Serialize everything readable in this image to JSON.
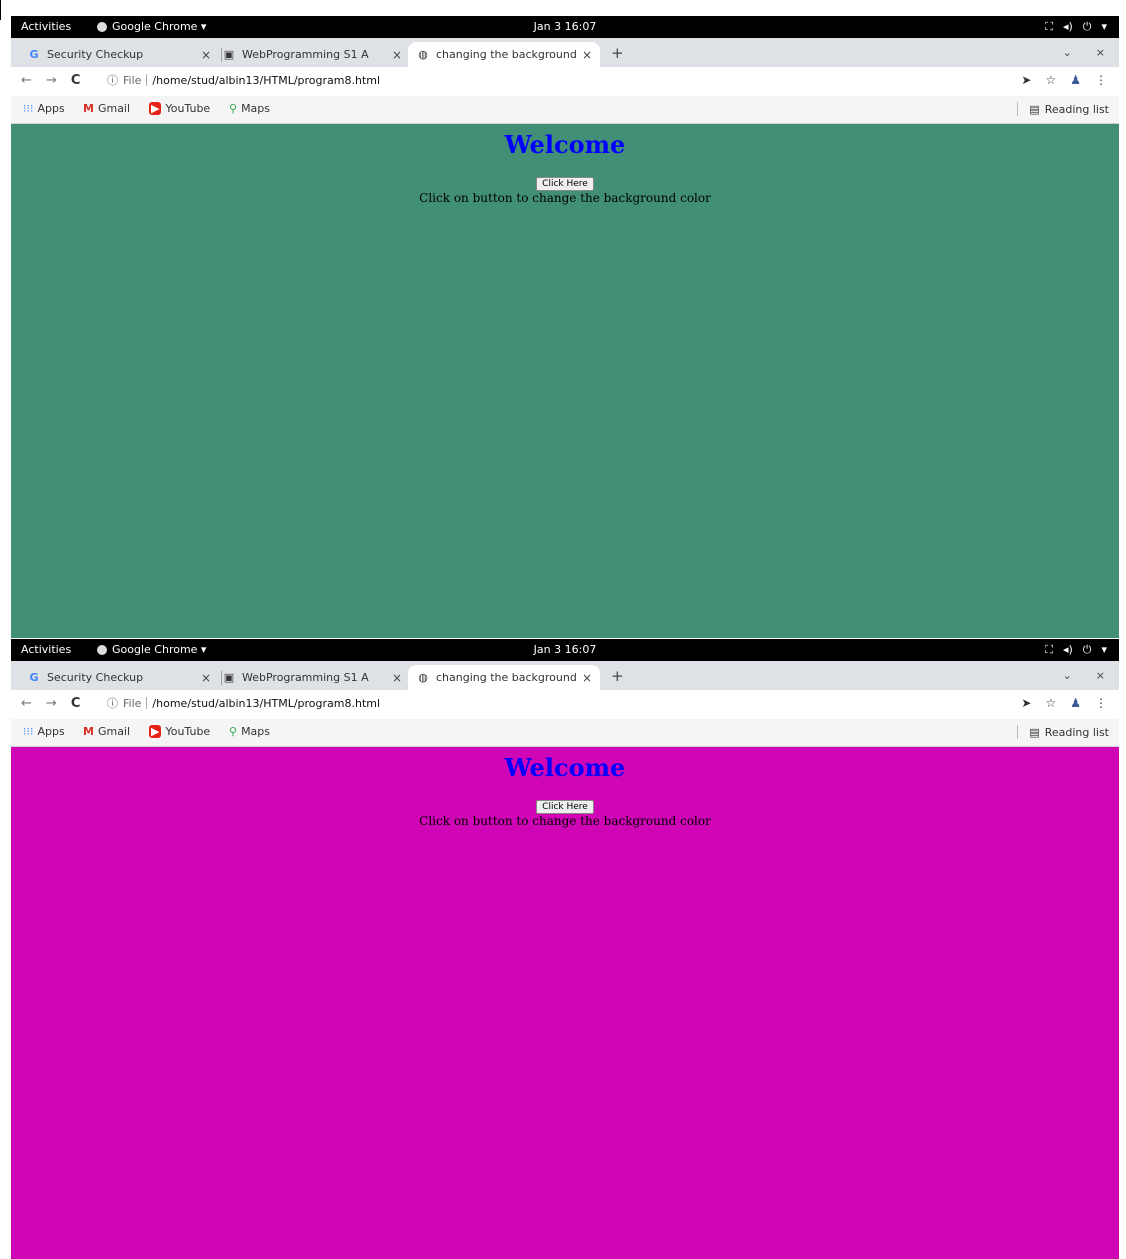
{
  "screens": [
    {
      "topbar": {
        "activities": "Activities",
        "app": "Google Chrome ▾",
        "clock": "Jan 3  16:07"
      },
      "tabs": [
        {
          "icon": "G",
          "title": "Security Checkup"
        },
        {
          "icon": "▣",
          "title": "WebProgramming S1 A"
        },
        {
          "icon": "◍",
          "title": "changing the background"
        }
      ],
      "address": {
        "scheme": "File",
        "url": "/home/stud/albin13/HTML/program8.html"
      },
      "bookmarks": {
        "apps": "Apps",
        "gmail": "Gmail",
        "youtube": "YouTube",
        "maps": "Maps",
        "reading_list": "Reading list"
      },
      "page": {
        "heading": "Welcome",
        "button": "Click Here",
        "text": "Click on button to change the background color",
        "background": "#428f77"
      }
    },
    {
      "topbar": {
        "activities": "Activities",
        "app": "Google Chrome ▾",
        "clock": "Jan 3  16:07"
      },
      "tabs": [
        {
          "icon": "G",
          "title": "Security Checkup"
        },
        {
          "icon": "▣",
          "title": "WebProgramming S1 A"
        },
        {
          "icon": "◍",
          "title": "changing the background"
        }
      ],
      "address": {
        "scheme": "File",
        "url": "/home/stud/albin13/HTML/program8.html"
      },
      "bookmarks": {
        "apps": "Apps",
        "gmail": "Gmail",
        "youtube": "YouTube",
        "maps": "Maps",
        "reading_list": "Reading list"
      },
      "page": {
        "heading": "Welcome",
        "button": "Click Here",
        "text": "Click on button to change the background color",
        "background": "#d005b5"
      }
    }
  ],
  "icons": {
    "sys": [
      "network-icon",
      "volume-icon",
      "power-icon",
      "menu-caret-icon"
    ],
    "tab_close": "×",
    "new_tab": "+",
    "tab_search": "⌄",
    "window_close": "×"
  },
  "colors": {
    "heading": "#0000ff",
    "topbar": "#000000",
    "tabstrip": "#dee1e6"
  }
}
